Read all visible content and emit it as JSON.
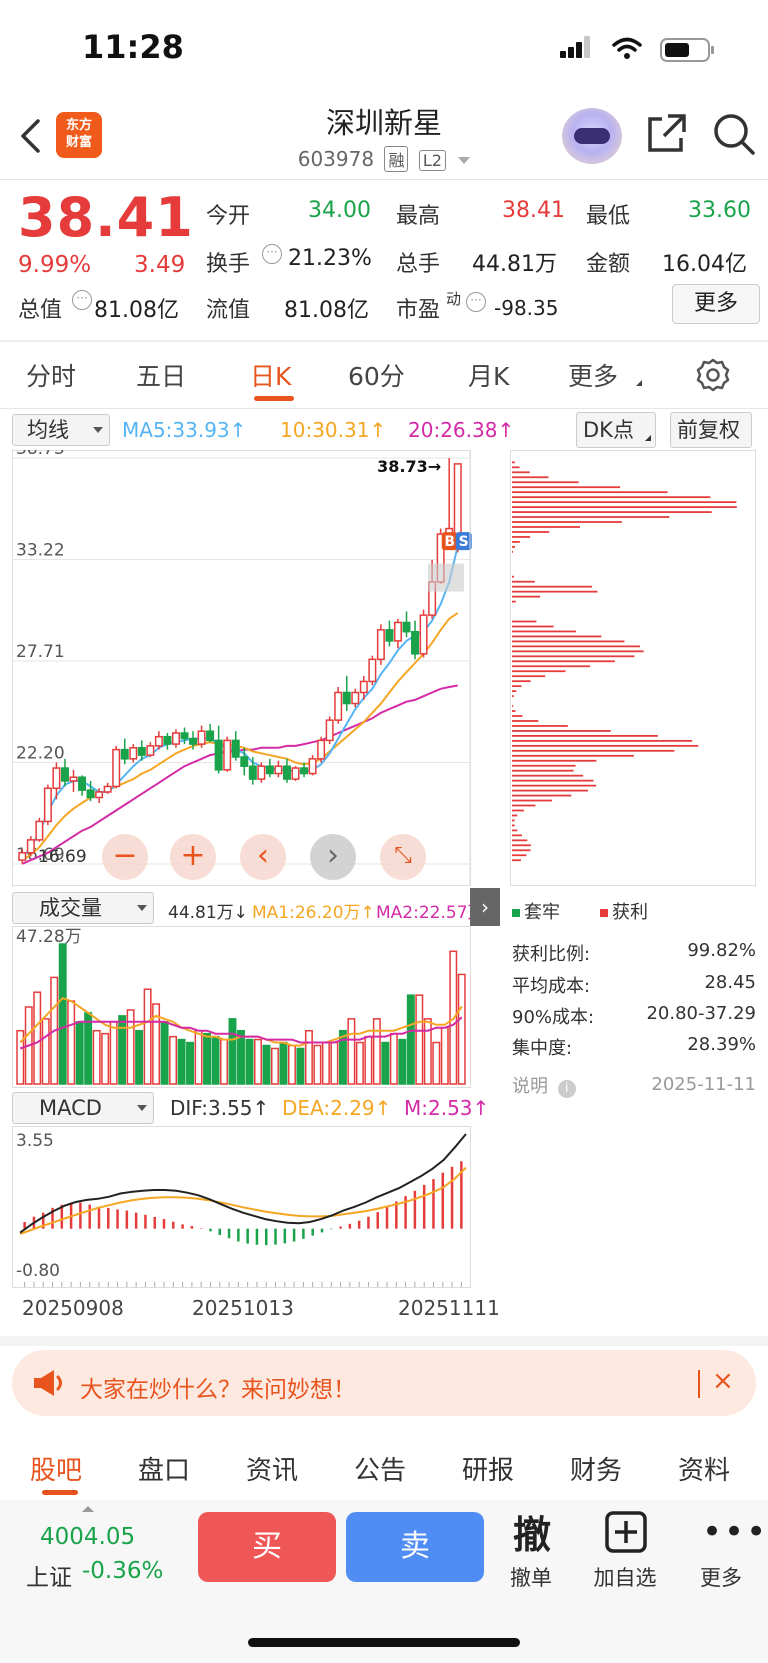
{
  "status": {
    "time": "11:28"
  },
  "header": {
    "title": "深圳新星",
    "code": "603978",
    "tag_rong": "融",
    "tag_l2": "L2",
    "logo_line1": "东方",
    "logo_line2": "财富"
  },
  "quote": {
    "price": "38.41",
    "change_pct": "9.99%",
    "change": "3.49",
    "total_value_label": "总值",
    "total_value": "81.08亿",
    "open_label": "今开",
    "open": "34.00",
    "high_label": "最高",
    "high": "38.41",
    "low_label": "最低",
    "low": "33.60",
    "turnover_label": "换手",
    "turnover": "21.23%",
    "volume_label": "总手",
    "volume": "44.81万",
    "amount_label": "金额",
    "amount": "16.04亿",
    "float_label": "流值",
    "float_value": "81.08亿",
    "pe_label": "市盈",
    "pe_sup": "动",
    "pe": "-98.35",
    "more": "更多"
  },
  "tabs": [
    "分时",
    "五日",
    "日K",
    "60分",
    "月K",
    "更多"
  ],
  "active_tab": "日K",
  "kline": {
    "selector": "均线",
    "ma5": "MA5:33.93↑",
    "ma10": "10:30.31↑",
    "ma20": "20:26.38↑",
    "dk_button": "DK点",
    "fq_button": "前复权",
    "price_ticks": [
      "38.73",
      "33.22",
      "27.71",
      "22.20",
      "16.69"
    ],
    "high_marker": "38.73→",
    "low_marker": "16.69",
    "bs_b": "B",
    "bs_s": "S"
  },
  "volume": {
    "selector": "成交量",
    "vol": "44.81万↓",
    "ma1": "MA1:26.20万↑",
    "ma2": "MA2:22.57万",
    "max_label": "47.28万"
  },
  "macd": {
    "selector": "MACD",
    "dif": "DIF:3.55↑",
    "dea": "DEA:2.29↑",
    "m": "M:2.53↑",
    "max": "3.55",
    "min": "-0.80",
    "dates": [
      "20250908",
      "20251013",
      "20251111"
    ]
  },
  "chips": {
    "legend_trapped": "套牢",
    "legend_profit": "获利",
    "profit_ratio_label": "获利比例:",
    "profit_ratio": "99.82%",
    "avg_cost_label": "平均成本:",
    "avg_cost": "28.45",
    "cost90_label": "90%成本:",
    "cost90": "20.80-37.29",
    "concentration_label": "集中度:",
    "concentration": "28.39%",
    "note_label": "说明",
    "date": "2025-11-11"
  },
  "banner": {
    "text": "大家在炒什么？来问妙想！"
  },
  "bottom_tabs": [
    "股吧",
    "盘口",
    "资讯",
    "公告",
    "研报",
    "财务",
    "资料"
  ],
  "footer": {
    "index_value": "4004.05",
    "index_name": "上证",
    "index_change": "-0.36%",
    "buy": "买",
    "sell": "卖",
    "cancel_icon_text": "撤",
    "cancel": "撤单",
    "add_watch": "加自选",
    "more": "更多"
  },
  "colors": {
    "up": "#e63b3b",
    "down": "#19a34a",
    "accent": "#e8541e",
    "ma5": "#56b4f5",
    "ma10": "#f5a623",
    "ma20": "#d42aa6"
  },
  "chart_data": [
    {
      "type": "candlestick",
      "title": "",
      "x_labels": [
        "20250908",
        "20251013",
        "20251111"
      ],
      "ylim": [
        16.69,
        38.73
      ],
      "candles": [
        [
          16.9,
          17.5,
          16.7,
          17.3
        ],
        [
          17.3,
          18.2,
          17.1,
          18.0
        ],
        [
          18.0,
          19.2,
          17.9,
          19.0
        ],
        [
          19.0,
          21.0,
          18.8,
          20.8
        ],
        [
          20.8,
          22.2,
          20.2,
          21.9
        ],
        [
          21.9,
          22.4,
          20.9,
          21.2
        ],
        [
          21.2,
          21.8,
          20.6,
          21.4
        ],
        [
          21.4,
          21.5,
          20.4,
          20.7
        ],
        [
          20.7,
          21.2,
          20.1,
          20.3
        ],
        [
          20.3,
          20.8,
          20.0,
          20.6
        ],
        [
          20.6,
          21.1,
          20.5,
          20.9
        ],
        [
          20.9,
          23.1,
          20.8,
          22.9
        ],
        [
          22.9,
          23.5,
          22.1,
          22.4
        ],
        [
          22.4,
          23.2,
          22.2,
          23.0
        ],
        [
          23.0,
          23.4,
          22.3,
          22.6
        ],
        [
          22.6,
          23.3,
          22.5,
          23.1
        ],
        [
          23.1,
          23.9,
          22.9,
          23.6
        ],
        [
          23.6,
          23.8,
          22.9,
          23.2
        ],
        [
          23.2,
          24.0,
          23.0,
          23.8
        ],
        [
          23.8,
          24.1,
          23.2,
          23.5
        ],
        [
          23.5,
          23.9,
          22.9,
          23.2
        ],
        [
          23.2,
          24.2,
          23.0,
          23.9
        ],
        [
          23.9,
          24.3,
          23.3,
          23.4
        ],
        [
          23.4,
          24.2,
          21.6,
          21.8
        ],
        [
          21.8,
          23.6,
          21.7,
          23.4
        ],
        [
          23.4,
          23.9,
          22.3,
          22.5
        ],
        [
          22.5,
          23.0,
          21.5,
          22.0
        ],
        [
          22.0,
          22.5,
          21.0,
          21.3
        ],
        [
          21.3,
          22.2,
          21.1,
          22.0
        ],
        [
          22.0,
          22.4,
          21.4,
          21.6
        ],
        [
          21.6,
          22.3,
          21.4,
          22.0
        ],
        [
          22.0,
          22.4,
          21.1,
          21.3
        ],
        [
          21.3,
          22.0,
          21.2,
          21.9
        ],
        [
          21.9,
          22.2,
          21.4,
          21.6
        ],
        [
          21.6,
          22.6,
          21.5,
          22.4
        ],
        [
          22.4,
          23.6,
          22.2,
          23.4
        ],
        [
          23.4,
          24.7,
          23.2,
          24.5
        ],
        [
          24.5,
          26.3,
          24.3,
          26.0
        ],
        [
          26.0,
          26.9,
          25.0,
          25.4
        ],
        [
          25.4,
          26.2,
          25.2,
          26.0
        ],
        [
          26.0,
          26.9,
          25.6,
          26.6
        ],
        [
          26.6,
          28.0,
          26.4,
          27.8
        ],
        [
          27.8,
          29.7,
          27.5,
          29.4
        ],
        [
          29.4,
          29.9,
          28.5,
          28.8
        ],
        [
          28.8,
          30.0,
          28.4,
          29.8
        ],
        [
          29.8,
          30.4,
          29.0,
          29.3
        ],
        [
          29.3,
          29.9,
          27.8,
          28.1
        ],
        [
          28.1,
          30.5,
          27.9,
          30.2
        ],
        [
          30.2,
          33.2,
          30.0,
          32.0
        ],
        [
          32.0,
          34.9,
          31.9,
          34.6
        ],
        [
          34.6,
          38.73,
          34.3,
          34.9
        ],
        [
          34.0,
          38.41,
          33.6,
          38.41
        ]
      ],
      "ma5": [
        17.0,
        17.6,
        18.4,
        19.5,
        20.4,
        21.0,
        21.2,
        21.2,
        20.9,
        20.6,
        20.6,
        21.0,
        21.5,
        22.0,
        22.4,
        22.6,
        23.0,
        23.2,
        23.3,
        23.4,
        23.5,
        23.5,
        23.5,
        23.2,
        23.0,
        22.9,
        22.7,
        22.2,
        22.0,
        21.9,
        21.8,
        21.8,
        21.7,
        21.7,
        21.8,
        22.1,
        22.7,
        23.5,
        24.3,
        25.1,
        25.7,
        26.2,
        27.0,
        27.6,
        28.3,
        28.8,
        29.1,
        29.3,
        29.9,
        30.8,
        32.0,
        33.93
      ],
      "ma10": [
        16.9,
        17.2,
        17.6,
        18.2,
        18.8,
        19.3,
        19.7,
        20.0,
        20.3,
        20.5,
        20.7,
        20.9,
        21.1,
        21.3,
        21.6,
        21.8,
        22.1,
        22.4,
        22.7,
        22.9,
        23.1,
        23.2,
        23.3,
        23.2,
        23.2,
        23.1,
        23.0,
        22.8,
        22.7,
        22.6,
        22.5,
        22.4,
        22.2,
        22.1,
        22.2,
        22.4,
        22.8,
        23.2,
        23.6,
        24.0,
        24.4,
        24.9,
        25.4,
        26.0,
        26.6,
        27.1,
        27.6,
        28.1,
        28.7,
        29.4,
        30.0,
        30.31
      ],
      "ma20": [
        16.7,
        16.9,
        17.1,
        17.3,
        17.6,
        17.9,
        18.2,
        18.5,
        18.7,
        19.0,
        19.3,
        19.6,
        19.9,
        20.2,
        20.5,
        20.8,
        21.1,
        21.4,
        21.7,
        22.0,
        22.2,
        22.4,
        22.6,
        22.7,
        22.8,
        22.8,
        22.9,
        22.9,
        23.0,
        23.0,
        23.0,
        23.1,
        23.1,
        23.2,
        23.3,
        23.4,
        23.6,
        23.8,
        24.0,
        24.2,
        24.4,
        24.6,
        24.9,
        25.1,
        25.3,
        25.5,
        25.6,
        25.8,
        26.0,
        26.2,
        26.3,
        26.38
      ]
    },
    {
      "type": "bar",
      "title": "成交量",
      "ylim": [
        0,
        47.28
      ],
      "unit": "万",
      "values": [
        18,
        26,
        31,
        22,
        36,
        47.28,
        28,
        21,
        24,
        18,
        17,
        21,
        23,
        25,
        18,
        32,
        27,
        21,
        16,
        15,
        14,
        18,
        17,
        16,
        15,
        22,
        18,
        15,
        15,
        13,
        12,
        14,
        13,
        12,
        18,
        13,
        14,
        14,
        18,
        22,
        14,
        16,
        22,
        14,
        17,
        15,
        30,
        30,
        22,
        14,
        19,
        44.81,
        37
      ],
      "ma1": [
        14,
        17,
        20,
        23,
        26,
        29,
        28,
        26,
        24,
        22,
        20,
        19,
        19,
        19,
        20,
        21,
        23,
        22,
        21,
        19,
        18,
        17,
        16,
        16,
        15,
        15,
        16,
        16,
        16,
        15,
        14,
        14,
        13,
        13,
        14,
        14,
        14,
        15,
        16,
        17,
        17,
        18,
        18,
        18,
        18,
        19,
        20,
        21,
        21,
        20,
        20,
        22,
        26.2
      ],
      "ma2": [
        12,
        13,
        14,
        16,
        18,
        19,
        20,
        21,
        21,
        21,
        21,
        21,
        21,
        21,
        21,
        21,
        21,
        21,
        20,
        19,
        19,
        18,
        18,
        17,
        17,
        17,
        16,
        16,
        16,
        15,
        15,
        15,
        15,
        14,
        14,
        14,
        14,
        14,
        15,
        15,
        15,
        16,
        16,
        16,
        17,
        17,
        18,
        18,
        18,
        19,
        19,
        20,
        22.57
      ]
    },
    {
      "type": "bar",
      "title": "MACD",
      "ylim": [
        -0.8,
        3.55
      ],
      "macd_bar": [
        0.25,
        0.45,
        0.6,
        0.78,
        0.9,
        0.97,
        0.98,
        0.9,
        0.82,
        0.78,
        0.72,
        0.68,
        0.6,
        0.52,
        0.44,
        0.36,
        0.26,
        0.16,
        0.1,
        0.02,
        -0.1,
        -0.24,
        -0.36,
        -0.48,
        -0.56,
        -0.6,
        -0.62,
        -0.6,
        -0.55,
        -0.48,
        -0.38,
        -0.26,
        -0.14,
        -0.02,
        0.08,
        0.18,
        0.3,
        0.45,
        0.62,
        0.82,
        1.02,
        1.22,
        1.42,
        1.64,
        1.86,
        2.1,
        2.32,
        2.53
      ],
      "dif": [
        -0.15,
        0.15,
        0.42,
        0.66,
        0.86,
        1.0,
        1.08,
        1.12,
        1.2,
        1.32,
        1.38,
        1.42,
        1.45,
        1.45,
        1.42,
        1.35,
        1.25,
        1.1,
        0.92,
        0.75,
        0.6,
        0.48,
        0.36,
        0.28,
        0.22,
        0.2,
        0.25,
        0.36,
        0.5,
        0.68,
        0.82,
        0.98,
        1.18,
        1.35,
        1.52,
        1.75,
        1.98,
        2.25,
        2.58,
        3.05,
        3.55
      ],
      "dea": [
        -0.2,
        -0.05,
        0.1,
        0.24,
        0.38,
        0.52,
        0.65,
        0.78,
        0.88,
        0.98,
        1.06,
        1.12,
        1.16,
        1.18,
        1.18,
        1.16,
        1.12,
        1.06,
        0.98,
        0.9,
        0.8,
        0.72,
        0.64,
        0.58,
        0.52,
        0.48,
        0.46,
        0.46,
        0.48,
        0.54,
        0.6,
        0.66,
        0.74,
        0.84,
        0.94,
        1.06,
        1.2,
        1.36,
        1.56,
        1.88,
        2.29
      ]
    }
  ]
}
